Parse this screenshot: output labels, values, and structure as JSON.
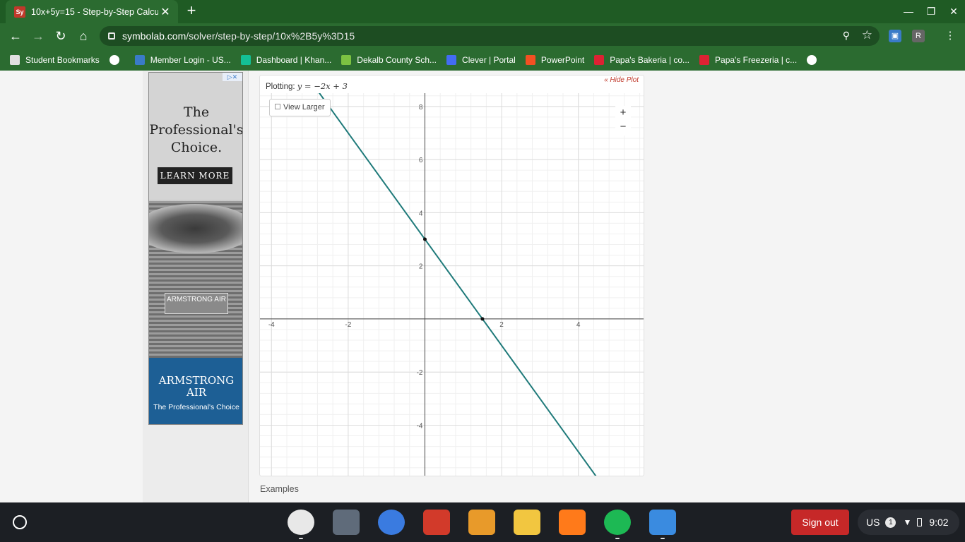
{
  "browser": {
    "tab_title": "10x+5y=15 - Step-by-Step Calcul",
    "tab_favicon_text": "Sy",
    "url_domain": "symbolab.com",
    "url_path": "/solver/step-by-step/10x%2B5y%3D15",
    "profile_initial": "R"
  },
  "bookmarks": [
    {
      "label": "Student Bookmarks",
      "icon": "folder-icon",
      "color": "#e0e0e0"
    },
    {
      "label": "",
      "icon": "globe-icon",
      "color": "#ffffff"
    },
    {
      "label": "Member Login - US...",
      "icon": "flag-icon",
      "color": "#3a7bc8"
    },
    {
      "label": "Dashboard | Khan...",
      "icon": "khan-icon",
      "color": "#14bf96"
    },
    {
      "label": "Dekalb County Sch...",
      "icon": "c-green-icon",
      "color": "#7cc242"
    },
    {
      "label": "Clever | Portal",
      "icon": "clever-icon",
      "color": "#436cf2"
    },
    {
      "label": "PowerPoint",
      "icon": "microsoft-icon",
      "color": "#f25022"
    },
    {
      "label": "Papa's Bakeria | co...",
      "icon": "game-icon",
      "color": "#d23"
    },
    {
      "label": "Papa's Freezeria | c...",
      "icon": "game-icon",
      "color": "#d23"
    },
    {
      "label": "",
      "icon": "google-icon",
      "color": "#ffffff"
    }
  ],
  "ad": {
    "headline": "The Professional's Choice.",
    "cta": "LEARN MORE",
    "badge": "ARMSTRONG AIR",
    "brand": "ARMSTRONG AIR",
    "tagline": "The Professional's Choice",
    "adchoices": "▷✕"
  },
  "plot": {
    "plotting_label": "Plotting:",
    "equation": "y = −2x + 3",
    "hide_plot": "« Hide Plot",
    "view_larger": "View Larger",
    "zoom_in": "+",
    "zoom_out": "−"
  },
  "chart_data": {
    "type": "line",
    "title": "",
    "xlabel": "",
    "ylabel": "",
    "xlim": [
      -4.3,
      5.7
    ],
    "ylim": [
      -5.9,
      8.5
    ],
    "x_ticks": [
      -4,
      -2,
      2,
      4
    ],
    "y_ticks": [
      -4,
      -2,
      2,
      4,
      6,
      8
    ],
    "grid": true,
    "series": [
      {
        "name": "",
        "x": [
          -4.3,
          5.7
        ],
        "y": [
          11.6,
          -8.4
        ],
        "color": "#1f7a7a"
      }
    ],
    "points": [
      {
        "x": 0,
        "y": 3
      },
      {
        "x": 1.5,
        "y": 0
      }
    ]
  },
  "examples_label": "Examples",
  "shelf": {
    "apps": [
      {
        "name": "chrome-app",
        "color": "#e8e8e8"
      },
      {
        "name": "files-app-gray",
        "color": "#5f6b7a"
      },
      {
        "name": "files-app",
        "color": "#3a7be0"
      },
      {
        "name": "phone-app",
        "color": "#d23a2a"
      },
      {
        "name": "game-app",
        "color": "#e89a2a"
      },
      {
        "name": "verse-app",
        "color": "#f2c640"
      },
      {
        "name": "soundcloud-app",
        "color": "#ff7a1a"
      },
      {
        "name": "spotify-app",
        "color": "#1db954"
      },
      {
        "name": "messages-app",
        "color": "#3a8be0"
      }
    ],
    "sign_out": "Sign out",
    "locale": "US",
    "notifications": "1",
    "time": "9:02"
  }
}
